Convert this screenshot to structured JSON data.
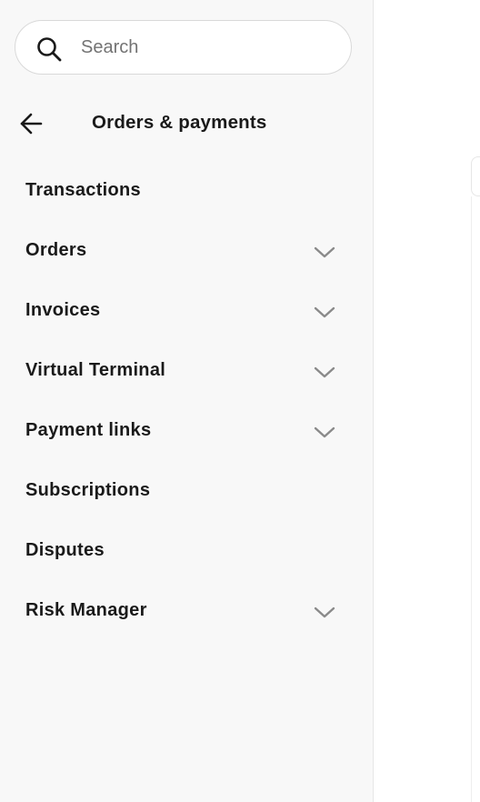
{
  "search": {
    "placeholder": "Search",
    "value": ""
  },
  "header": {
    "title": "Orders & payments",
    "back_icon": "arrow-left-icon"
  },
  "nav": {
    "items": [
      {
        "label": "Transactions",
        "expandable": false
      },
      {
        "label": "Orders",
        "expandable": true
      },
      {
        "label": "Invoices",
        "expandable": true
      },
      {
        "label": "Virtual Terminal",
        "expandable": true
      },
      {
        "label": "Payment links",
        "expandable": true
      },
      {
        "label": "Subscriptions",
        "expandable": false
      },
      {
        "label": "Disputes",
        "expandable": false
      },
      {
        "label": "Risk Manager",
        "expandable": true
      }
    ]
  },
  "colors": {
    "sidebar_bg": "#f8f8f8",
    "text": "#1a1a1a",
    "chevron": "#8a8a8a",
    "placeholder": "#737373"
  }
}
